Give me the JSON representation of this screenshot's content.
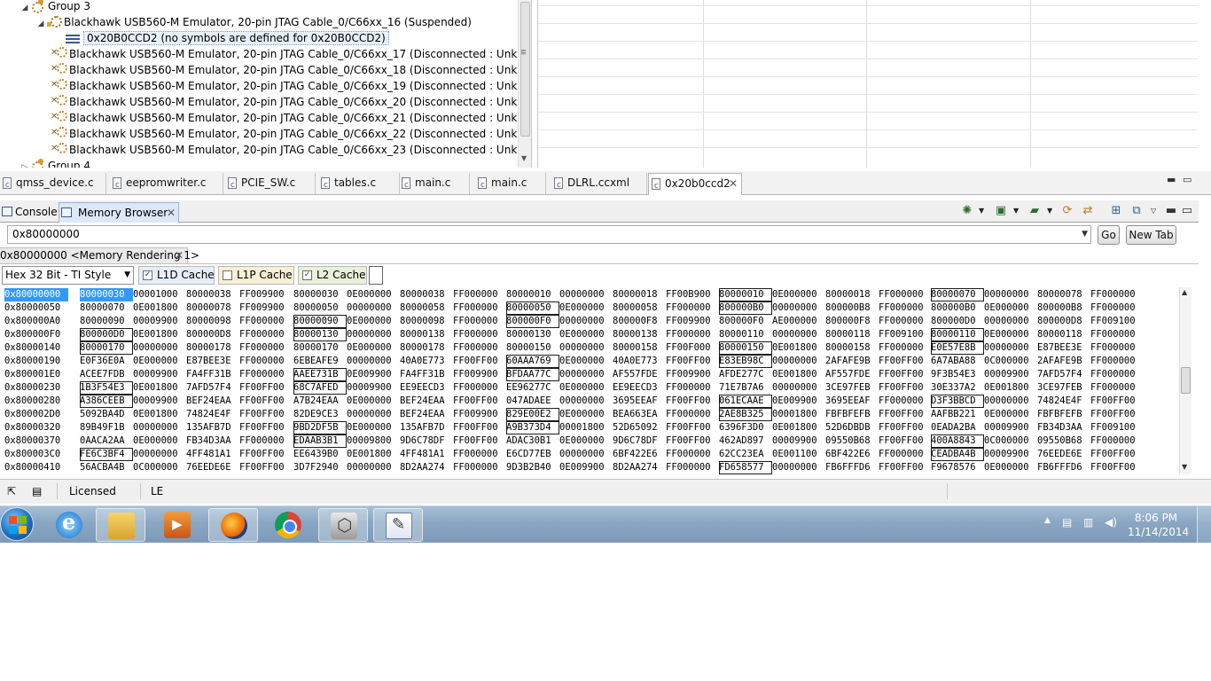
{
  "debug_tree": {
    "group3": "Group 3",
    "suspended_core": "Blackhawk USB560-M Emulator, 20-pin JTAG Cable_0/C66xx_16 (Suspended)",
    "frame": "0x20B0CCD2  (no symbols are defined for 0x20B0CCD2)",
    "disconnected": [
      "Blackhawk USB560-M Emulator, 20-pin JTAG Cable_0/C66xx_17 (Disconnected : Unknown)",
      "Blackhawk USB560-M Emulator, 20-pin JTAG Cable_0/C66xx_18 (Disconnected : Unknown)",
      "Blackhawk USB560-M Emulator, 20-pin JTAG Cable_0/C66xx_19 (Disconnected : Unknown)",
      "Blackhawk USB560-M Emulator, 20-pin JTAG Cable_0/C66xx_20 (Disconnected : Unknown)",
      "Blackhawk USB560-M Emulator, 20-pin JTAG Cable_0/C66xx_21 (Disconnected : Unknown)",
      "Blackhawk USB560-M Emulator, 20-pin JTAG Cable_0/C66xx_22 (Disconnected : Unknown)",
      "Blackhawk USB560-M Emulator, 20-pin JTAG Cable_0/C66xx_23 (Disconnected : Unknown)"
    ],
    "group4": "Group 4"
  },
  "editor_tabs": [
    {
      "label": "qmss_device.c",
      "icon": "c-file-icon"
    },
    {
      "label": "eepromwriter.c",
      "icon": "c-file-icon"
    },
    {
      "label": "PCIE_SW.c",
      "icon": "c-file-icon"
    },
    {
      "label": "tables.c",
      "icon": "c-file-icon"
    },
    {
      "label": "main.c",
      "icon": "c-file-icon"
    },
    {
      "label": "main.c",
      "icon": "c-file-icon"
    },
    {
      "label": "DLRL.ccxml",
      "icon": "xml-file-icon"
    },
    {
      "label": "0x20b0ccd2",
      "icon": "c-file-icon"
    }
  ],
  "view_tabs": {
    "console": "Console",
    "memory_browser": "Memory Browser"
  },
  "memory": {
    "address_input": "0x80000000",
    "go_label": "Go",
    "new_tab_label": "New Tab",
    "rendering_tab": "0x80000000 <Memory Rendering 1>",
    "format": "Hex 32 Bit - TI Style",
    "l1d": "L1D Cache",
    "l1p": "L1P Cache",
    "l2": "L2 Cache",
    "l1d_checked": true,
    "l1p_checked": false,
    "l2_checked": true,
    "rows": [
      {
        "addr": "0x80000000",
        "vals": [
          "80000030",
          "00001000",
          "80000038",
          "FF009900",
          "80000030",
          "0E000000",
          "80000038",
          "FF000000",
          "80000010",
          "00000000",
          "80000018",
          "FF00B900",
          "80000010",
          "0E000000",
          "80000018",
          "FF000000",
          "80000070",
          "00000000",
          "80000078",
          "FF000000"
        ]
      },
      {
        "addr": "0x80000050",
        "vals": [
          "80000070",
          "0E001800",
          "80000078",
          "FF009900",
          "80000050",
          "00000000",
          "80000058",
          "FF000000",
          "80000050",
          "0E000000",
          "80000058",
          "FF000000",
          "800000B0",
          "00000000",
          "800000B8",
          "FF000000",
          "800000B0",
          "0E000000",
          "800000B8",
          "FF000000"
        ]
      },
      {
        "addr": "0x800000A0",
        "vals": [
          "80000090",
          "00009900",
          "80000098",
          "FF000000",
          "80000090",
          "0E000000",
          "80000098",
          "FF000000",
          "800000F0",
          "00000000",
          "800000F8",
          "FF009900",
          "800000F0",
          "AE000000",
          "800000F8",
          "FF000000",
          "800000D0",
          "00000000",
          "800000D8",
          "FF009100"
        ]
      },
      {
        "addr": "0x800000F0",
        "vals": [
          "800000D0",
          "0E001800",
          "800000D8",
          "FF000000",
          "80000130",
          "00000000",
          "80000138",
          "FF000000",
          "80000130",
          "0E000000",
          "80000138",
          "FF000000",
          "80000110",
          "00000000",
          "80000118",
          "FF009100",
          "80000110",
          "0E000000",
          "80000118",
          "FF000000"
        ]
      },
      {
        "addr": "0x80000140",
        "vals": [
          "80000170",
          "00000000",
          "80000178",
          "FF000000",
          "80000170",
          "0E000000",
          "80000178",
          "FF000000",
          "80000150",
          "00000000",
          "80000158",
          "FF00F000",
          "80000150",
          "0E001800",
          "80000158",
          "FF000000",
          "E0E57E8B",
          "00000000",
          "E87BEE3E",
          "FF000000"
        ]
      },
      {
        "addr": "0x80000190",
        "vals": [
          "E0F36E0A",
          "0E000000",
          "E87BEE3E",
          "FF000000",
          "6EBEAFE9",
          "00000000",
          "40A0E773",
          "FF00FF00",
          "60AAA769",
          "0E000000",
          "40A0E773",
          "FF00FF00",
          "E83EB98C",
          "00000000",
          "2AFAFE9B",
          "FF00FF00",
          "6A7ABA88",
          "0C000000",
          "2AFAFE9B",
          "FF000000"
        ]
      },
      {
        "addr": "0x800001E0",
        "vals": [
          "ACEE7FDB",
          "00009900",
          "FA4FF31B",
          "FF000000",
          "AAEE731B",
          "0E009900",
          "FA4FF31B",
          "FF009900",
          "BFDAA77C",
          "00000000",
          "AF557FDE",
          "FF009900",
          "AFDE277C",
          "0E001800",
          "AF557FDE",
          "FF00FF00",
          "9F3B54E3",
          "00009900",
          "7AFD57F4",
          "FF000000"
        ]
      },
      {
        "addr": "0x80000230",
        "vals": [
          "1B3F54E3",
          "0E001800",
          "7AFD57F4",
          "FF00FF00",
          "68C7AFED",
          "00009900",
          "EE9EECD3",
          "FF000000",
          "EE96277C",
          "0E000000",
          "EE9EECD3",
          "FF000000",
          "71E7B7A6",
          "00000000",
          "3CE97FEB",
          "FF00FF00",
          "30E337A2",
          "0E001800",
          "3CE97FEB",
          "FF000000"
        ]
      },
      {
        "addr": "0x80000280",
        "vals": [
          "A386CEEB",
          "00009900",
          "BEF24EAA",
          "FF00FF00",
          "A7B24EAA",
          "0E000000",
          "BEF24EAA",
          "FF00FF00",
          "047ADAEE",
          "00000000",
          "3695EEAF",
          "FF00FF00",
          "061ECAAE",
          "0E009900",
          "3695EEAF",
          "FF000000",
          "D3F3BBCD",
          "00000000",
          "74824E4F",
          "FF00FF00"
        ]
      },
      {
        "addr": "0x800002D0",
        "vals": [
          "5092BA4D",
          "0E001800",
          "74824E4F",
          "FF00FF00",
          "82DE9CE3",
          "00000000",
          "BEF24EAA",
          "FF009900",
          "829E00E2",
          "0E000000",
          "BEA663EA",
          "FF000000",
          "2AE8B325",
          "00001800",
          "FBFBFEFB",
          "FF00FF00",
          "AAFBB221",
          "0E000000",
          "FBFBFEFB",
          "FF00FF00"
        ]
      },
      {
        "addr": "0x80000320",
        "vals": [
          "89B49F1B",
          "00000000",
          "135AFB7D",
          "FF00FF00",
          "9BD2DF5B",
          "0E000000",
          "135AFB7D",
          "FF00FF00",
          "A9B373D4",
          "00001800",
          "52D65092",
          "FF00FF00",
          "6396F3D0",
          "0E001800",
          "52D6DBDB",
          "FF00FF00",
          "0EADA2BA",
          "00009900",
          "FB34D3AA",
          "FF009100"
        ]
      },
      {
        "addr": "0x80000370",
        "vals": [
          "0AACA2AA",
          "0E000000",
          "FB34D3AA",
          "FF000000",
          "EDAAB3B1",
          "00009800",
          "9D6C78DF",
          "FF00FF00",
          "ADAC30B1",
          "0E000000",
          "9D6C78DF",
          "FF00FF00",
          "462AD897",
          "00009900",
          "09550B68",
          "FF00FF00",
          "400A8843",
          "0C000000",
          "09550B68",
          "FF000000"
        ]
      },
      {
        "addr": "0x800003C0",
        "vals": [
          "FE6C3BF4",
          "00000000",
          "4FF481A1",
          "FF00FF00",
          "EE6439B0",
          "0E001800",
          "4FF481A1",
          "FF000000",
          "E6CD77EB",
          "00000000",
          "6BF422E6",
          "FF000000",
          "62CC23EA",
          "0E001100",
          "6BF422E6",
          "FF000000",
          "CEADBA4B",
          "00009900",
          "76EEDE6E",
          "FF00FF00"
        ]
      },
      {
        "addr": "0x80000410",
        "vals": [
          "56ACBA4B",
          "0C000000",
          "76EEDE6E",
          "FF00FF00",
          "3D7F2940",
          "00000000",
          "8D2AA274",
          "FF000000",
          "9D3B2B40",
          "0E009900",
          "8D2AA274",
          "FF000000",
          "FD658577",
          "00000000",
          "FB6FFFD6",
          "FF00FF00",
          "F9678576",
          "0E000000",
          "FB6FFFD6",
          "FF00FF00"
        ]
      }
    ]
  },
  "status_bar": {
    "licensed": "Licensed",
    "endian": "LE"
  },
  "taskbar": {
    "apps": [
      "internet-explorer",
      "windows-explorer",
      "media-player",
      "firefox",
      "chrome",
      "code-composer-studio",
      "notepad"
    ],
    "time": "8:06 PM",
    "date": "11/14/2014"
  }
}
